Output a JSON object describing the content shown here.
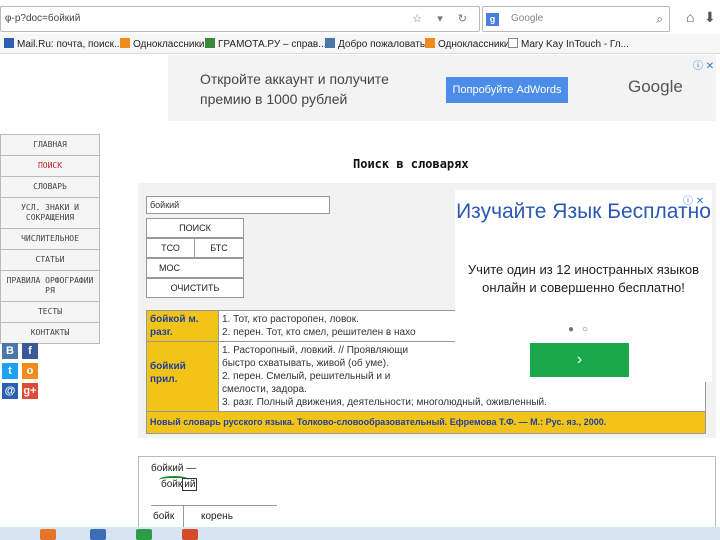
{
  "browser": {
    "url": "φ-p?doc=бойкий",
    "search_text": "Google",
    "search_logo": "g",
    "icons": [
      "star-icon",
      "refresh-icon",
      "home-icon",
      "download-icon"
    ]
  },
  "bookmarks": [
    {
      "label": "Mail.Ru: почта, поиск...",
      "color": "#2b5fb3"
    },
    {
      "label": "Одноклассники",
      "color": "#f08c1d"
    },
    {
      "label": "ГРАМОТА.РУ – справ...",
      "color": "#3a8a3a"
    },
    {
      "label": "Добро пожаловать",
      "color": "#4a76a8"
    },
    {
      "label": "Одноклассники",
      "color": "#f08c1d"
    },
    {
      "label": "Mary Kay InTouch - Гл...",
      "color": "#888888"
    }
  ],
  "top_ad": {
    "text": "Откройте аккаунт и получите премию в 1000 рублей",
    "button": "Попробуйте AdWords",
    "brand": "Google"
  },
  "nav": [
    {
      "label": "ГЛАВНАЯ"
    },
    {
      "label": "ПОИСК"
    },
    {
      "label": "СЛОВАРЬ"
    },
    {
      "label": "УСЛ. ЗНАКИ И СОКРАЩЕНИЯ"
    },
    {
      "label": "ЧИСЛИТЕЛЬНОЕ"
    },
    {
      "label": "СТАТЬИ"
    },
    {
      "label": "ПРАВИЛА ОРФОГРАФИИ РЯ"
    },
    {
      "label": "ТЕСТЫ"
    },
    {
      "label": "КОНТАКТЫ"
    }
  ],
  "social": {
    "vk": "В",
    "fb": "f",
    "tw": "t",
    "ok": "о",
    "mail": "@",
    "gplus": "g+"
  },
  "page_title": "Поиск в словарях",
  "search": {
    "query": "бойкий",
    "btn_search": "ПОИСК",
    "btn_tso": "ТСО",
    "btn_bts": "БТС",
    "btn_mos": "МОС",
    "btn_clear": "ОЧИСТИТЬ"
  },
  "results": [
    {
      "term": "бойкой",
      "gram": "м. разг.",
      "lines": [
        "1. Тот, кто расторопен, ловок.",
        "2. перен. Тот, кто смел, решителен в нахо"
      ]
    },
    {
      "term": "бойкий",
      "gram": "прил.",
      "lines": [
        "1. Расторопный, ловкий. // Проявляющи",
        "быстро схватывать, живой (об уме).",
        "2. перен. Смелый, решительный и и",
        "смелости, задора.",
        "3. разг. Полный движения, деятельности; многолюдный, оживленный."
      ]
    }
  ],
  "source": "Новый словарь русского языка. Толково-словообразовательный. Ефремова Т.Ф. — М.: Рус. яз., 2000.",
  "side_ad": {
    "title": "Изучайте Язык Бесплатно",
    "text": "Учите один из 12 иностранных языков онлайн и совершенно бесплатно!",
    "button": "›"
  },
  "adchoice": "ⓘ ✕",
  "morph": {
    "head": "бойкий —",
    "stem": "бойк",
    "suffix": "ий",
    "col1": "бойк",
    "col2": "корень"
  }
}
